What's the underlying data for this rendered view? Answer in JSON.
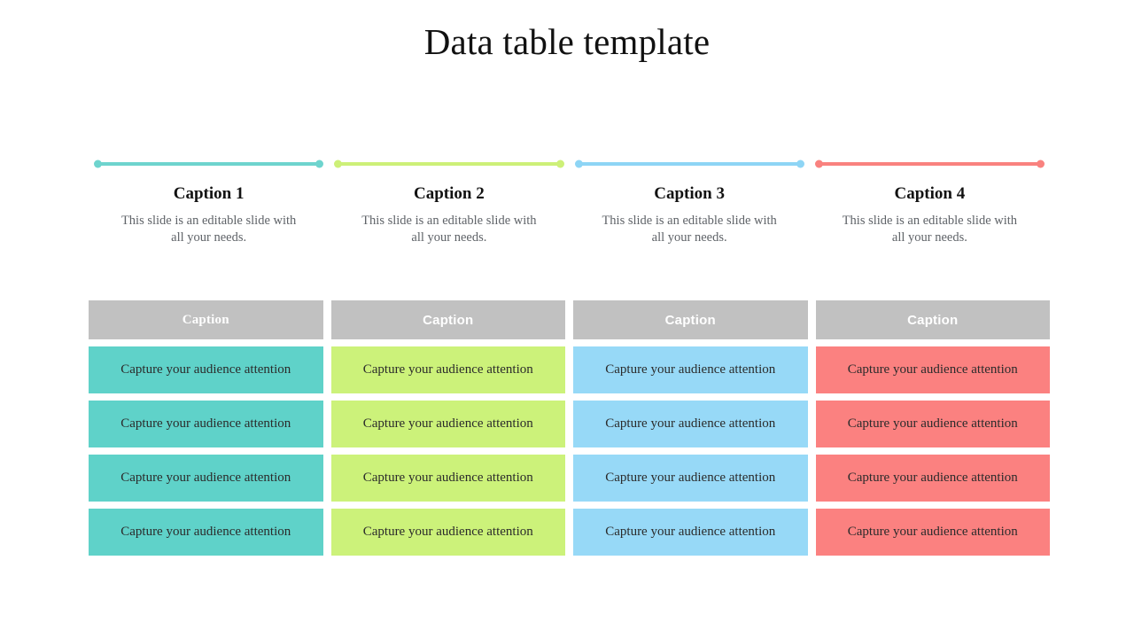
{
  "slide": {
    "title": "Data table template",
    "background": "#ffffff"
  },
  "captions": [
    {
      "title": "Caption 1",
      "description": "This slide is an editable slide with all your needs.",
      "line_color": "#6ed4ce",
      "dot_color": "#6ed4ce"
    },
    {
      "title": "Caption 2",
      "description": "This slide is an editable slide with all your needs.",
      "line_color": "#cdf078",
      "dot_color": "#cdf078"
    },
    {
      "title": "Caption 3",
      "description": "This slide is an editable slide with all your needs.",
      "line_color": "#8ed5f5",
      "dot_color": "#8ed5f5"
    },
    {
      "title": "Caption 4",
      "description": "This slide is an editable slide with all your needs.",
      "line_color": "#f9827f",
      "dot_color": "#f9827f"
    }
  ],
  "table": {
    "header_background": "#c1c1c1",
    "header_text_color": "#ffffff",
    "headers": [
      "Caption",
      "Caption",
      "Caption",
      "Caption"
    ],
    "column_colors": [
      "#5fd2c9",
      "#ccf27a",
      "#97d9f7",
      "#fb8180"
    ],
    "rows": [
      [
        "Capture your audience attention",
        "Capture your audience attention",
        "Capture your audience attention",
        "Capture your audience attention"
      ],
      [
        "Capture your audience attention",
        "Capture your audience attention",
        "Capture your audience attention",
        "Capture your audience attention"
      ],
      [
        "Capture your audience attention",
        "Capture your audience attention",
        "Capture your audience attention",
        "Capture your audience attention"
      ],
      [
        "Capture your audience attention",
        "Capture your audience attention",
        "Capture your audience attention",
        "Capture your audience attention"
      ]
    ]
  }
}
